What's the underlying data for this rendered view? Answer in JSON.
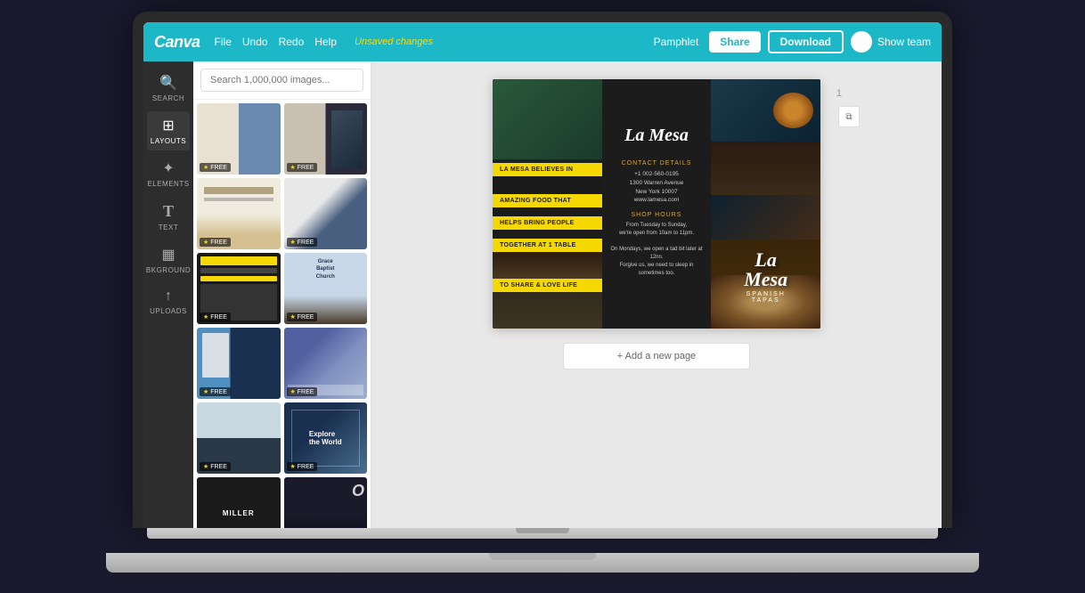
{
  "topbar": {
    "logo": "Canva",
    "menu": {
      "file": "File",
      "undo": "Undo",
      "redo": "Redo",
      "help": "Help"
    },
    "unsaved": "Unsaved changes",
    "doc_title": "Pamphlet",
    "share_label": "Share",
    "download_label": "Download",
    "show_team_label": "Show team"
  },
  "sidebar": {
    "items": [
      {
        "id": "search",
        "icon": "🔍",
        "label": "SEARCH"
      },
      {
        "id": "layouts",
        "icon": "⊞",
        "label": "LAYOUTS"
      },
      {
        "id": "elements",
        "icon": "✦",
        "label": "ELEMENTS"
      },
      {
        "id": "text",
        "icon": "T",
        "label": "TEXT"
      },
      {
        "id": "background",
        "icon": "▦",
        "label": "BKGROUND"
      },
      {
        "id": "uploads",
        "icon": "↑",
        "label": "UPLOADS"
      }
    ]
  },
  "panel": {
    "search_placeholder": "Search 1,000,000 images...",
    "templates": [
      {
        "id": 1,
        "free": true
      },
      {
        "id": 2,
        "free": true
      },
      {
        "id": 3,
        "free": true
      },
      {
        "id": 4,
        "free": true
      },
      {
        "id": 5,
        "free": true
      },
      {
        "id": 6,
        "free": true
      },
      {
        "id": 7,
        "free": true
      },
      {
        "id": 8,
        "free": true
      },
      {
        "id": 9,
        "free": true
      },
      {
        "id": 10,
        "free": true
      },
      {
        "id": 11,
        "free": true
      },
      {
        "id": 12,
        "free": true
      }
    ]
  },
  "pamphlet": {
    "labels": [
      "LA MESA BELIEVES IN",
      "AMAZING FOOD THAT",
      "HELPS BRING PEOPLE",
      "TOGETHER AT 1 TABLE",
      "TO SHARE & LOVE LIFE"
    ],
    "panel_middle": {
      "logo": "La Mesa",
      "contact_title": "CONTACT DETAILS",
      "phone": "+1 002-560-0195",
      "address": "1300 Warren Avenue",
      "city": "New York 10007",
      "website": "www.lamesa.com",
      "shop_title": "SHOP HOURS",
      "hours_text": "From Tuesday to Sunday,\nwe're open from 10am to 11pm.",
      "monday_text": "On Mondays, we open a tad bit later at 12nn.\nForgive us, we need to sleep in sometimes too."
    },
    "panel_right": {
      "logo": "La Mesa",
      "tagline": "SPANISH TAPAS"
    }
  },
  "canvas": {
    "page_number": "1",
    "add_page_label": "+ Add a new page"
  }
}
